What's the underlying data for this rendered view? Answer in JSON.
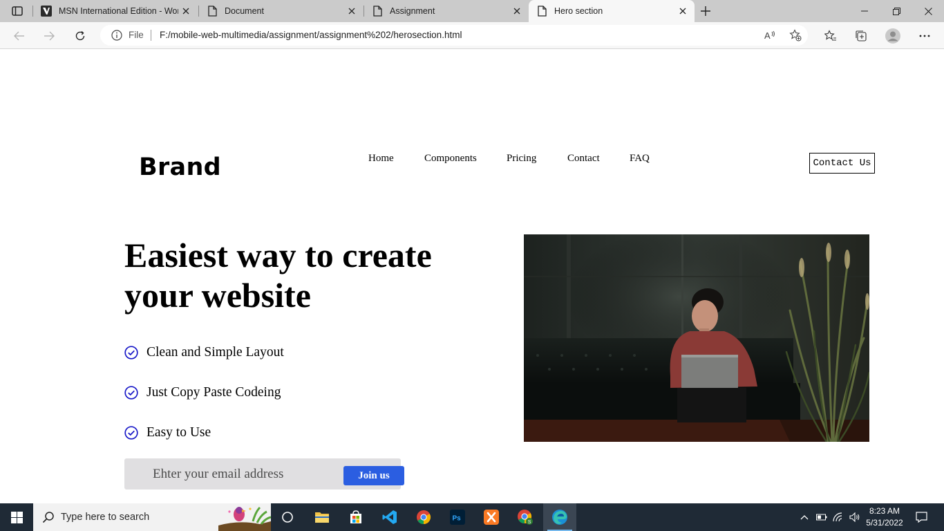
{
  "browser": {
    "tabs": [
      {
        "title": "MSN International Edition - Worl",
        "active": false,
        "icon": "msn-icon"
      },
      {
        "title": "Document",
        "active": false,
        "icon": "page-icon"
      },
      {
        "title": "Assignment",
        "active": false,
        "icon": "page-icon"
      },
      {
        "title": "Hero section",
        "active": true,
        "icon": "page-icon"
      }
    ],
    "address": {
      "scheme_label": "File",
      "url": "F:/mobile-web-multimedia/assignment/assignment%202/herosection.html"
    }
  },
  "page": {
    "brand": "Brand",
    "nav": [
      "Home",
      "Components",
      "Pricing",
      "Contact",
      "FAQ"
    ],
    "contact_button": "Contact Us",
    "hero": {
      "title_line1": "Easiest way to create",
      "title_line2": "your website",
      "features": [
        "Clean and Simple Layout",
        "Just Copy Paste Codeing",
        "Easy to Use"
      ],
      "email_placeholder": "Ehter your email address",
      "join_button": "Join us"
    },
    "accent_color": "#2b5ee1",
    "check_color": "#1a1ac8"
  },
  "taskbar": {
    "search_placeholder": "Type here to search",
    "time": "8:23 AM",
    "date": "5/31/2022",
    "apps": [
      "task-view-icon",
      "file-explorer-icon",
      "store-icon",
      "vscode-icon",
      "chrome-icon",
      "photoshop-icon",
      "xampp-icon",
      "chrome-profile-icon",
      "edge-icon"
    ]
  }
}
